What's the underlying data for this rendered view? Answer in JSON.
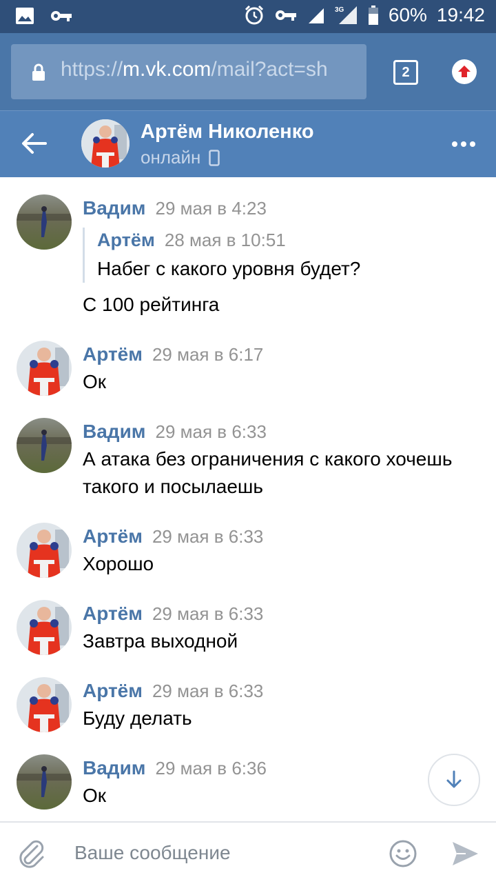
{
  "status_bar": {
    "battery": "60%",
    "clock": "19:42",
    "network": "3G"
  },
  "browser": {
    "url_scheme": "https://",
    "url_host": "m.vk.com",
    "url_path": "/mail?act=sh",
    "tab_count": "2"
  },
  "chat": {
    "name": "Артём Николенко",
    "status": "онлайн"
  },
  "messages": [
    {
      "author": "Вадим",
      "time": "29 мая в 4:23",
      "quote_author": "Артём",
      "quote_time": "28 мая в 10:51",
      "quote_text": "Набег с какого уровня будет?",
      "text": "С 100 рейтинга"
    },
    {
      "author": "Артём",
      "time": "29 мая в 6:17",
      "text": "Ок"
    },
    {
      "author": "Вадим",
      "time": "29 мая в 6:33",
      "text": "А атака без ограничения с какого хочешь такого и посылаешь"
    },
    {
      "author": "Артём",
      "time": "29 мая в 6:33",
      "text": "Хорошо"
    },
    {
      "author": "Артём",
      "time": "29 мая в 6:33",
      "text": "Завтра выходной"
    },
    {
      "author": "Артём",
      "time": "29 мая в 6:33",
      "text": "Буду делать"
    },
    {
      "author": "Вадим",
      "time": "29 мая в 6:36",
      "text": "Ок"
    }
  ],
  "composer": {
    "placeholder": "Ваше сообщение"
  },
  "colors": {
    "header": "#5181b8",
    "browser": "#4a76a8",
    "status_bar": "#2f4f79",
    "author": "#4a76a8"
  },
  "icons": {
    "back": "arrow-left-icon",
    "menu": "more-dots-icon",
    "attach": "paperclip-icon",
    "emoji": "smile-icon",
    "send": "send-icon",
    "scroll": "arrow-down-icon"
  }
}
